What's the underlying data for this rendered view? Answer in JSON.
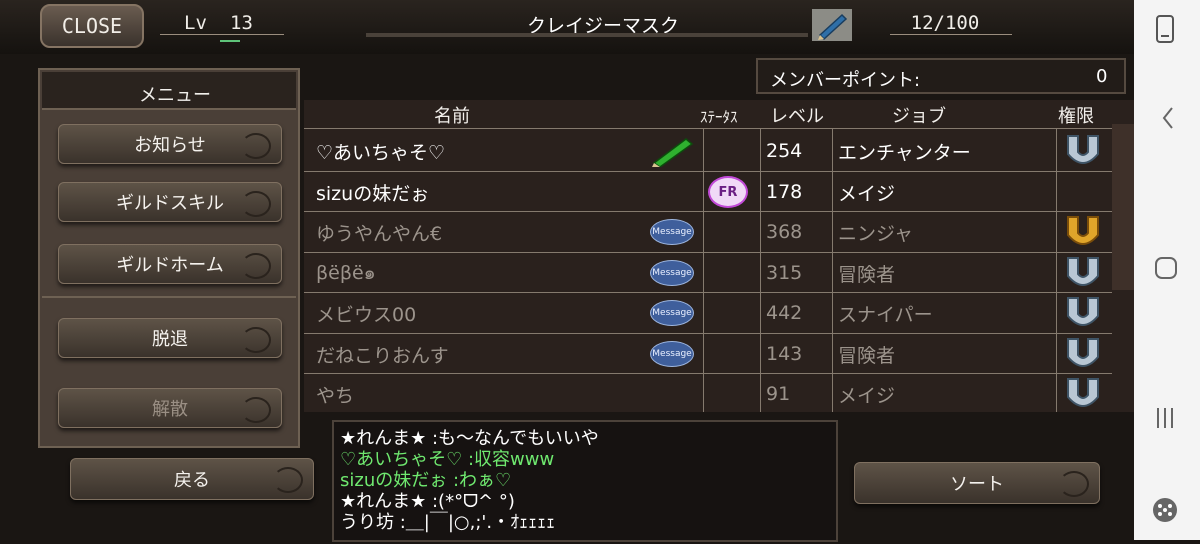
{
  "header": {
    "close_label": "CLOSE",
    "level_label": "Lv",
    "level_value": "13",
    "guild_name": "クレイジーマスク",
    "members_count": "12/100"
  },
  "menu": {
    "title": "メニュー",
    "buttons": [
      {
        "label": "お知らせ",
        "enabled": true
      },
      {
        "label": "ギルドスキル",
        "enabled": true
      },
      {
        "label": "ギルドホーム",
        "enabled": true
      },
      {
        "label": "脱退",
        "enabled": true
      },
      {
        "label": "解散",
        "enabled": false
      }
    ],
    "back_label": "戻る"
  },
  "member_points": {
    "label": "メンバーポイント:",
    "value": "0"
  },
  "table": {
    "headers": {
      "name": "名前",
      "status": "ｽﾃｰﾀｽ",
      "level": "レベル",
      "job": "ジョブ",
      "rank": "権限"
    },
    "rows": [
      {
        "name": "♡あいちゃそ♡",
        "level": "254",
        "job": "エンチャンター",
        "online": true,
        "name_icon": "pencil-icon",
        "status_icon": "",
        "rank_icon": "silver-crest-icon"
      },
      {
        "name": "sizuの妹だぉ",
        "level": "178",
        "job": "メイジ",
        "online": true,
        "name_icon": "",
        "status_icon": "friend-request-icon",
        "rank_icon": ""
      },
      {
        "name": "ゆうやんやん€",
        "level": "368",
        "job": "ニンジャ",
        "online": false,
        "name_icon": "message-icon",
        "status_icon": "",
        "rank_icon": "gold-crest-icon"
      },
      {
        "name": "βëβë๑",
        "level": "315",
        "job": "冒険者",
        "online": false,
        "name_icon": "message-icon",
        "status_icon": "",
        "rank_icon": "silver-crest-icon"
      },
      {
        "name": "メビウス00",
        "level": "442",
        "job": "スナイパー",
        "online": false,
        "name_icon": "message-icon",
        "status_icon": "",
        "rank_icon": "silver-crest-icon"
      },
      {
        "name": "だねこりおんす",
        "level": "143",
        "job": "冒険者",
        "online": false,
        "name_icon": "message-icon",
        "status_icon": "",
        "rank_icon": "silver-crest-icon"
      },
      {
        "name": "やち",
        "level": "91",
        "job": "メイジ",
        "online": false,
        "name_icon": "",
        "status_icon": "",
        "rank_icon": "silver-crest-icon"
      }
    ],
    "message_badge_text": "Message",
    "fr_badge_text": "FR"
  },
  "chat": [
    {
      "text": "★れんま★ :も〜なんでもいいや",
      "color": "#ffffff"
    },
    {
      "text": "♡あいちゃそ♡ :収容www",
      "color": "#6fe86f"
    },
    {
      "text": "sizuの妹だぉ :わぁ♡",
      "color": "#6fe86f"
    },
    {
      "text": "★れんま★ :(*°ᗜ^ °)",
      "color": "#ffffff"
    },
    {
      "text": "うり坊 :＿|￣|○,;'.・ｵｪｪｪｪ",
      "color": "#ffffff"
    }
  ],
  "sort_label": "ソート",
  "colors": {
    "online_text": "#ffffff",
    "offline_text": "#9c948c",
    "chat_green": "#6fe86f"
  }
}
